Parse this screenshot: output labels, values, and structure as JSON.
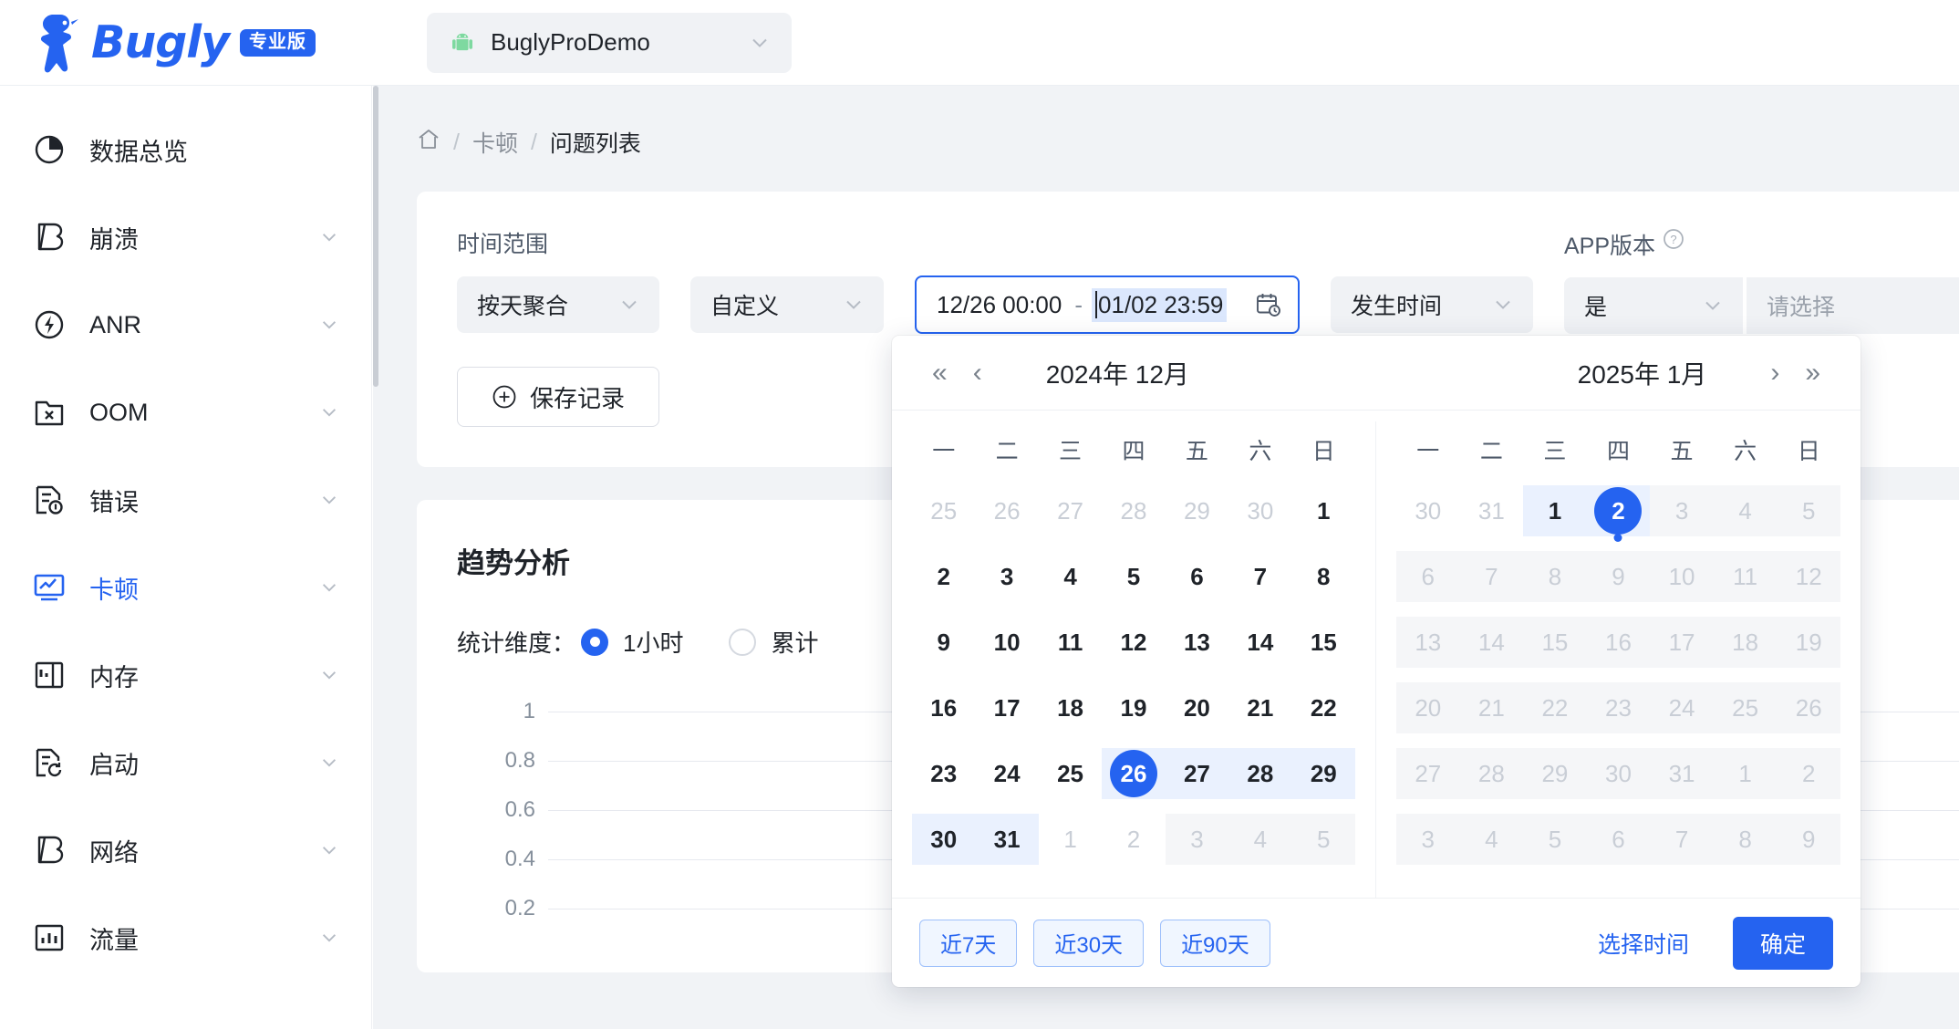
{
  "brand": {
    "name": "Bugly",
    "badge": "专业版"
  },
  "project": {
    "name": "BuglyProDemo",
    "icon": "android-icon"
  },
  "sidebar": {
    "items": [
      {
        "label": "数据总览",
        "icon": "pie-clock-icon",
        "expandable": false,
        "active": false
      },
      {
        "label": "崩溃",
        "icon": "bugly-b-icon",
        "expandable": true,
        "active": false
      },
      {
        "label": "ANR",
        "icon": "anr-bolt-icon",
        "expandable": true,
        "active": false
      },
      {
        "label": "OOM",
        "icon": "folder-x-icon",
        "expandable": true,
        "active": false
      },
      {
        "label": "错误",
        "icon": "doc-info-icon",
        "expandable": true,
        "active": false
      },
      {
        "label": "卡顿",
        "icon": "monitor-chart-icon",
        "expandable": true,
        "active": true
      },
      {
        "label": "内存",
        "icon": "memory-icon",
        "expandable": true,
        "active": false
      },
      {
        "label": "启动",
        "icon": "doc-refresh-icon",
        "expandable": true,
        "active": false
      },
      {
        "label": "网络",
        "icon": "bugly-b-icon",
        "expandable": true,
        "active": false
      },
      {
        "label": "流量",
        "icon": "bar-chart-icon",
        "expandable": true,
        "active": false
      }
    ]
  },
  "breadcrumb": {
    "home_icon": "home-icon",
    "items": [
      "卡顿",
      "问题列表"
    ],
    "separator": "/"
  },
  "filters": {
    "time_range_label": "时间范围",
    "aggregation": {
      "value": "按天聚合"
    },
    "preset": {
      "value": "自定义"
    },
    "date_range": {
      "start": "12/26 00:00",
      "separator": "-",
      "end": "01/02 23:59",
      "icon": "calendar-clock-icon"
    },
    "time_type": {
      "value": "发生时间"
    },
    "app_version_label": "APP版本",
    "app_version_help_icon": "question-icon",
    "version_match": {
      "value": "是"
    },
    "version_select": {
      "placeholder": "请选择"
    },
    "save_button": {
      "label": "保存记录",
      "icon": "plus-circle-icon"
    }
  },
  "trend": {
    "title": "趋势分析",
    "dimension_label": "统计维度：",
    "options": [
      {
        "label": "1小时",
        "selected": true
      },
      {
        "label": "累计",
        "selected": false
      }
    ]
  },
  "chart_data": {
    "type": "line",
    "title": "趋势分析",
    "xlabel": "",
    "ylabel": "",
    "ylim": [
      0,
      1
    ],
    "yticks": [
      "1",
      "0.8",
      "0.6",
      "0.4",
      "0.2"
    ],
    "grid": true,
    "series": [],
    "x": []
  },
  "picker": {
    "nav": {
      "prev_year": "«",
      "prev_month": "‹",
      "next_month": "›",
      "next_year": "»"
    },
    "left_month_title": "2024年 12月",
    "right_month_title": "2025年 1月",
    "weekdays": [
      "一",
      "二",
      "三",
      "四",
      "五",
      "六",
      "日"
    ],
    "left_days": [
      [
        {
          "d": "25",
          "s": "muted"
        },
        {
          "d": "26",
          "s": "muted"
        },
        {
          "d": "27",
          "s": "muted"
        },
        {
          "d": "28",
          "s": "muted"
        },
        {
          "d": "29",
          "s": "muted"
        },
        {
          "d": "30",
          "s": "muted"
        },
        {
          "d": "1",
          "s": "bold"
        }
      ],
      [
        {
          "d": "2",
          "s": "bold"
        },
        {
          "d": "3",
          "s": "bold"
        },
        {
          "d": "4",
          "s": "bold"
        },
        {
          "d": "5",
          "s": "bold"
        },
        {
          "d": "6",
          "s": "bold"
        },
        {
          "d": "7",
          "s": "bold"
        },
        {
          "d": "8",
          "s": "bold"
        }
      ],
      [
        {
          "d": "9",
          "s": "bold"
        },
        {
          "d": "10",
          "s": "bold"
        },
        {
          "d": "11",
          "s": "bold"
        },
        {
          "d": "12",
          "s": "bold"
        },
        {
          "d": "13",
          "s": "bold"
        },
        {
          "d": "14",
          "s": "bold"
        },
        {
          "d": "15",
          "s": "bold"
        }
      ],
      [
        {
          "d": "16",
          "s": "bold"
        },
        {
          "d": "17",
          "s": "bold"
        },
        {
          "d": "18",
          "s": "bold"
        },
        {
          "d": "19",
          "s": "bold"
        },
        {
          "d": "20",
          "s": "bold"
        },
        {
          "d": "21",
          "s": "bold"
        },
        {
          "d": "22",
          "s": "bold"
        }
      ],
      [
        {
          "d": "23",
          "s": "bold"
        },
        {
          "d": "24",
          "s": "bold"
        },
        {
          "d": "25",
          "s": "bold"
        },
        {
          "d": "26",
          "s": "sel"
        },
        {
          "d": "27",
          "s": "inrange bold"
        },
        {
          "d": "28",
          "s": "inrange bold"
        },
        {
          "d": "29",
          "s": "inrange bold"
        }
      ],
      [
        {
          "d": "30",
          "s": "inrange bold"
        },
        {
          "d": "31",
          "s": "inrange bold"
        },
        {
          "d": "1",
          "s": "dim"
        },
        {
          "d": "2",
          "s": "dim"
        },
        {
          "d": "3",
          "s": "dim disabled"
        },
        {
          "d": "4",
          "s": "dim disabled"
        },
        {
          "d": "5",
          "s": "dim disabled"
        }
      ]
    ],
    "right_days": [
      [
        {
          "d": "30",
          "s": "muted"
        },
        {
          "d": "31",
          "s": "muted"
        },
        {
          "d": "1",
          "s": "inrange bold"
        },
        {
          "d": "2",
          "s": "sel dot"
        },
        {
          "d": "3",
          "s": "dim disabled"
        },
        {
          "d": "4",
          "s": "dim disabled"
        },
        {
          "d": "5",
          "s": "dim disabled"
        }
      ],
      [
        {
          "d": "6",
          "s": "dim disabled"
        },
        {
          "d": "7",
          "s": "dim disabled"
        },
        {
          "d": "8",
          "s": "dim disabled"
        },
        {
          "d": "9",
          "s": "dim disabled"
        },
        {
          "d": "10",
          "s": "dim disabled"
        },
        {
          "d": "11",
          "s": "dim disabled"
        },
        {
          "d": "12",
          "s": "dim disabled"
        }
      ],
      [
        {
          "d": "13",
          "s": "dim disabled"
        },
        {
          "d": "14",
          "s": "dim disabled"
        },
        {
          "d": "15",
          "s": "dim disabled"
        },
        {
          "d": "16",
          "s": "dim disabled"
        },
        {
          "d": "17",
          "s": "dim disabled"
        },
        {
          "d": "18",
          "s": "dim disabled"
        },
        {
          "d": "19",
          "s": "dim disabled"
        }
      ],
      [
        {
          "d": "20",
          "s": "dim disabled"
        },
        {
          "d": "21",
          "s": "dim disabled"
        },
        {
          "d": "22",
          "s": "dim disabled"
        },
        {
          "d": "23",
          "s": "dim disabled"
        },
        {
          "d": "24",
          "s": "dim disabled"
        },
        {
          "d": "25",
          "s": "dim disabled"
        },
        {
          "d": "26",
          "s": "dim disabled"
        }
      ],
      [
        {
          "d": "27",
          "s": "dim disabled"
        },
        {
          "d": "28",
          "s": "dim disabled"
        },
        {
          "d": "29",
          "s": "dim disabled"
        },
        {
          "d": "30",
          "s": "dim disabled"
        },
        {
          "d": "31",
          "s": "dim disabled"
        },
        {
          "d": "1",
          "s": "dim disabled"
        },
        {
          "d": "2",
          "s": "dim disabled"
        }
      ],
      [
        {
          "d": "3",
          "s": "dim disabled"
        },
        {
          "d": "4",
          "s": "dim disabled"
        },
        {
          "d": "5",
          "s": "dim disabled"
        },
        {
          "d": "6",
          "s": "dim disabled"
        },
        {
          "d": "7",
          "s": "dim disabled"
        },
        {
          "d": "8",
          "s": "dim disabled"
        },
        {
          "d": "9",
          "s": "dim disabled"
        }
      ]
    ],
    "quick_ranges": [
      "近7天",
      "近30天",
      "近90天"
    ],
    "select_time_link": "选择时间",
    "confirm_button": "确定"
  },
  "colors": {
    "accent": "#2563f0",
    "range_bg": "#eaf1fe",
    "muted": "#c9ced6",
    "page_bg": "#f1f3f6"
  }
}
